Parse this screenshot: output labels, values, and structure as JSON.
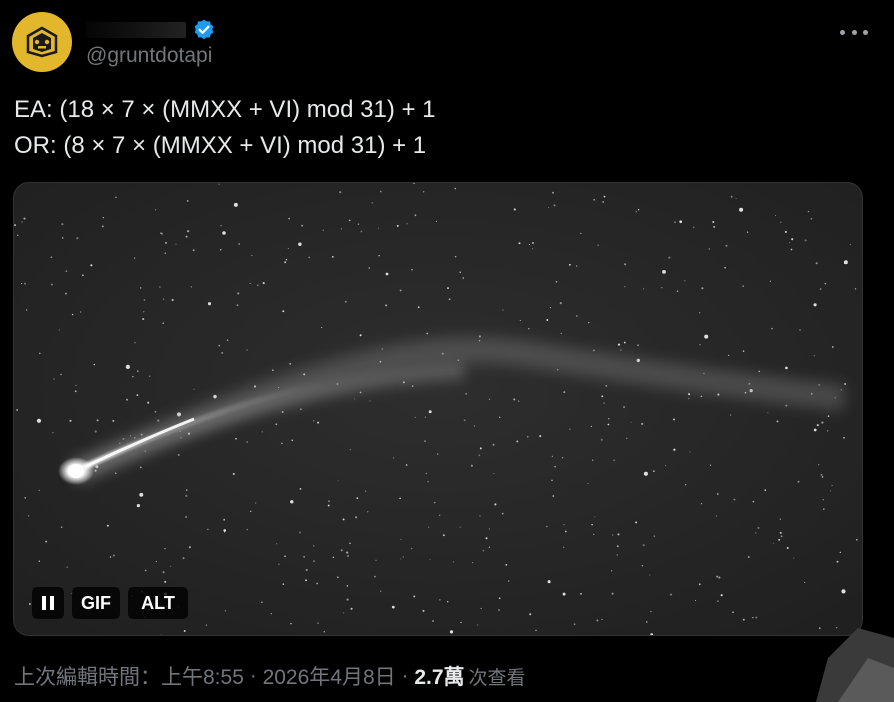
{
  "author": {
    "display_name": "",
    "handle": "@gruntdotapi",
    "verified": true,
    "avatar_color": "#e3b72b"
  },
  "tweet": {
    "lines": [
      "EA: (18 × 7 × (MMXX + VI) mod 31) + 1",
      "OR: (8 × 7 × (MMXX + VI) mod 31) + 1"
    ]
  },
  "media": {
    "type": "gif",
    "description_icon": "comet-in-night-sky",
    "controls": {
      "pause_icon": "pause-icon",
      "gif_label": "GIF",
      "alt_label": "ALT"
    }
  },
  "meta": {
    "edited_label": "上次編輯時間：",
    "time": "上午8:55",
    "separator1": "·",
    "date": "2026年4月8日",
    "separator2": "·",
    "views_count": "2.7萬",
    "views_label": "次查看"
  },
  "colors": {
    "background": "#000000",
    "text": "#e7e9ea",
    "secondary_text": "#71767b",
    "verified_blue": "#1d9bf0"
  }
}
